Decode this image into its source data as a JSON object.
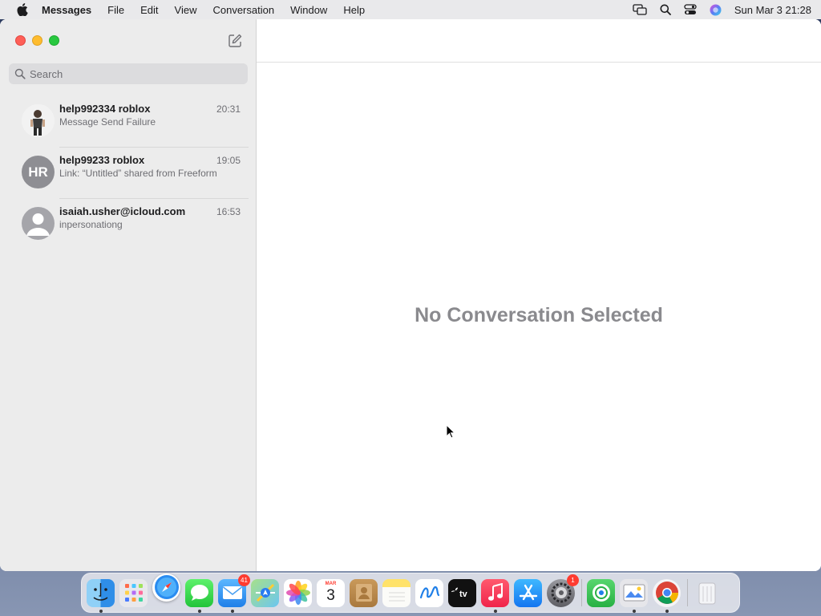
{
  "menubar": {
    "app_name": "Messages",
    "items": [
      "File",
      "Edit",
      "View",
      "Conversation",
      "Window",
      "Help"
    ],
    "clock": "Sun Mar 3  21:28"
  },
  "search": {
    "placeholder": "Search"
  },
  "conversations": [
    {
      "name": "help992334 roblox",
      "preview": "Message Send Failure",
      "time": "20:31",
      "avatar": "photo"
    },
    {
      "name": "help99233 roblox",
      "preview": "Link: “Untitled” shared from Freeform",
      "time": "19:05",
      "avatar": "initials",
      "initials": "HR"
    },
    {
      "name": "isaiah.usher@icloud.com",
      "preview": "inpersonationg",
      "time": "16:53",
      "avatar": "generic"
    }
  ],
  "main": {
    "empty_title": "No Conversation Selected"
  },
  "dock": {
    "apps": [
      {
        "name": "finder-icon",
        "running": true
      },
      {
        "name": "launchpad-icon",
        "running": false
      },
      {
        "name": "safari-icon",
        "running": false
      },
      {
        "name": "messages-icon",
        "running": true
      },
      {
        "name": "mail-icon",
        "running": true,
        "badge": "41"
      },
      {
        "name": "maps-icon",
        "running": false
      },
      {
        "name": "photos-icon",
        "running": false
      },
      {
        "name": "calendar-icon",
        "running": false,
        "month": "MAR",
        "day": "3"
      },
      {
        "name": "contacts-icon",
        "running": false
      },
      {
        "name": "notes-icon",
        "running": false
      },
      {
        "name": "freeform-icon",
        "running": false
      },
      {
        "name": "apple-tv-icon",
        "running": false,
        "label": "tv"
      },
      {
        "name": "music-icon",
        "running": true
      },
      {
        "name": "app-store-icon",
        "running": false
      },
      {
        "name": "system-settings-icon",
        "running": false,
        "badge": "1"
      },
      {
        "name": "find-my-icon",
        "running": false
      },
      {
        "name": "preview-icon",
        "running": true
      },
      {
        "name": "chrome-icon",
        "running": true
      },
      {
        "name": "trash-icon",
        "running": false
      }
    ]
  },
  "colors": {
    "close": "#fe5f57",
    "minimize": "#febc2e",
    "maximize": "#28c840",
    "badge": "#ff3b30"
  }
}
